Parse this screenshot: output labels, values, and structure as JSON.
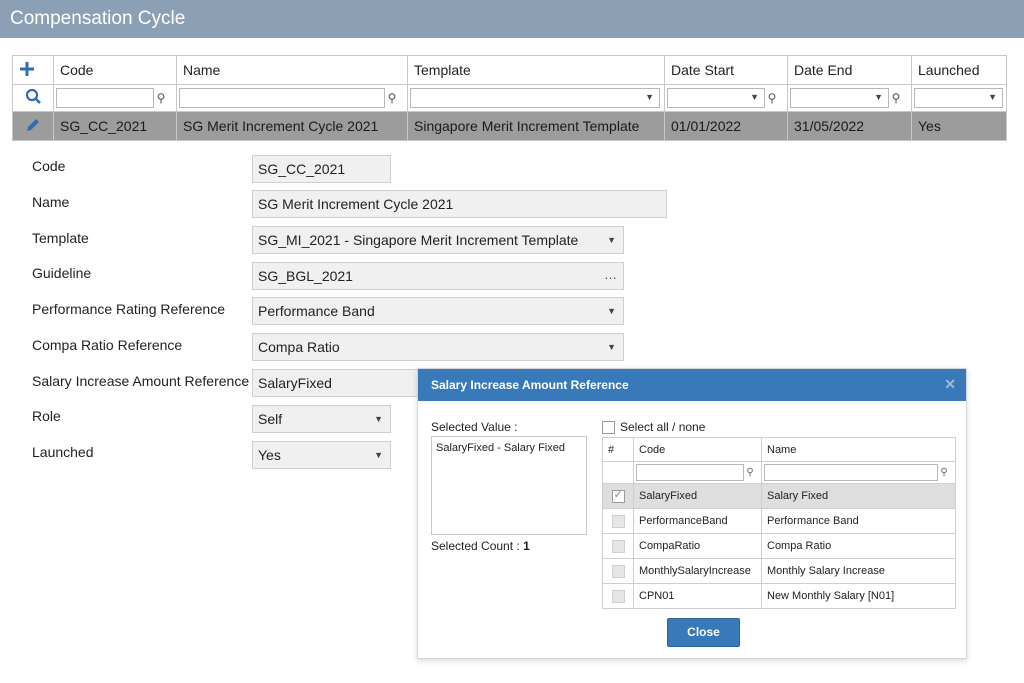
{
  "window": {
    "title": "Compensation Cycle"
  },
  "grid": {
    "columns": [
      "Code",
      "Name",
      "Template",
      "Date Start",
      "Date End",
      "Launched"
    ],
    "row": {
      "code": "SG_CC_2021",
      "name": "SG Merit Increment Cycle 2021",
      "template": "Singapore Merit Increment Template",
      "date_start": "01/01/2022",
      "date_end": "31/05/2022",
      "launched": "Yes"
    }
  },
  "form": {
    "fields": [
      {
        "label": "Code",
        "value": "SG_CC_2021"
      },
      {
        "label": "Name",
        "value": "SG Merit Increment Cycle 2021"
      },
      {
        "label": "Template",
        "value": "SG_MI_2021 - Singapore Merit Increment Template"
      },
      {
        "label": "Guideline",
        "value": "SG_BGL_2021"
      },
      {
        "label": "Performance Rating Reference",
        "value": "Performance Band"
      },
      {
        "label": "Compa Ratio Reference",
        "value": "Compa Ratio"
      },
      {
        "label": "Salary Increase Amount Reference",
        "value": "SalaryFixed"
      },
      {
        "label": "Role",
        "value": "Self"
      },
      {
        "label": "Launched",
        "value": "Yes"
      }
    ]
  },
  "dialog": {
    "title": "Salary Increase Amount Reference",
    "selected_value_label": "Selected Value :",
    "selected_values": [
      "SalaryFixed - Salary Fixed"
    ],
    "selected_count_label": "Selected Count :",
    "selected_count": "1",
    "select_all_label": "Select all / none",
    "columns": [
      "#",
      "Code",
      "Name"
    ],
    "rows": [
      {
        "code": "SalaryFixed",
        "name": "Salary Fixed",
        "checked": true
      },
      {
        "code": "PerformanceBand",
        "name": "Performance Band",
        "checked": false
      },
      {
        "code": "CompaRatio",
        "name": "Compa Ratio",
        "checked": false
      },
      {
        "code": "MonthlySalaryIncrease",
        "name": "Monthly Salary Increase",
        "checked": false
      },
      {
        "code": "CPN01",
        "name": "New Monthly Salary [N01]",
        "checked": false
      }
    ],
    "close_label": "Close"
  },
  "colors": {
    "accent": "#3779b9",
    "titlebar": "#8ba0b4",
    "selected_row": "#9c9c9c"
  },
  "icons": {
    "add": "plus-icon",
    "search": "search-icon",
    "edit": "pencil-icon",
    "filter": "pin-icon",
    "close": "close-icon",
    "dropdown": "chevron-down-icon"
  }
}
